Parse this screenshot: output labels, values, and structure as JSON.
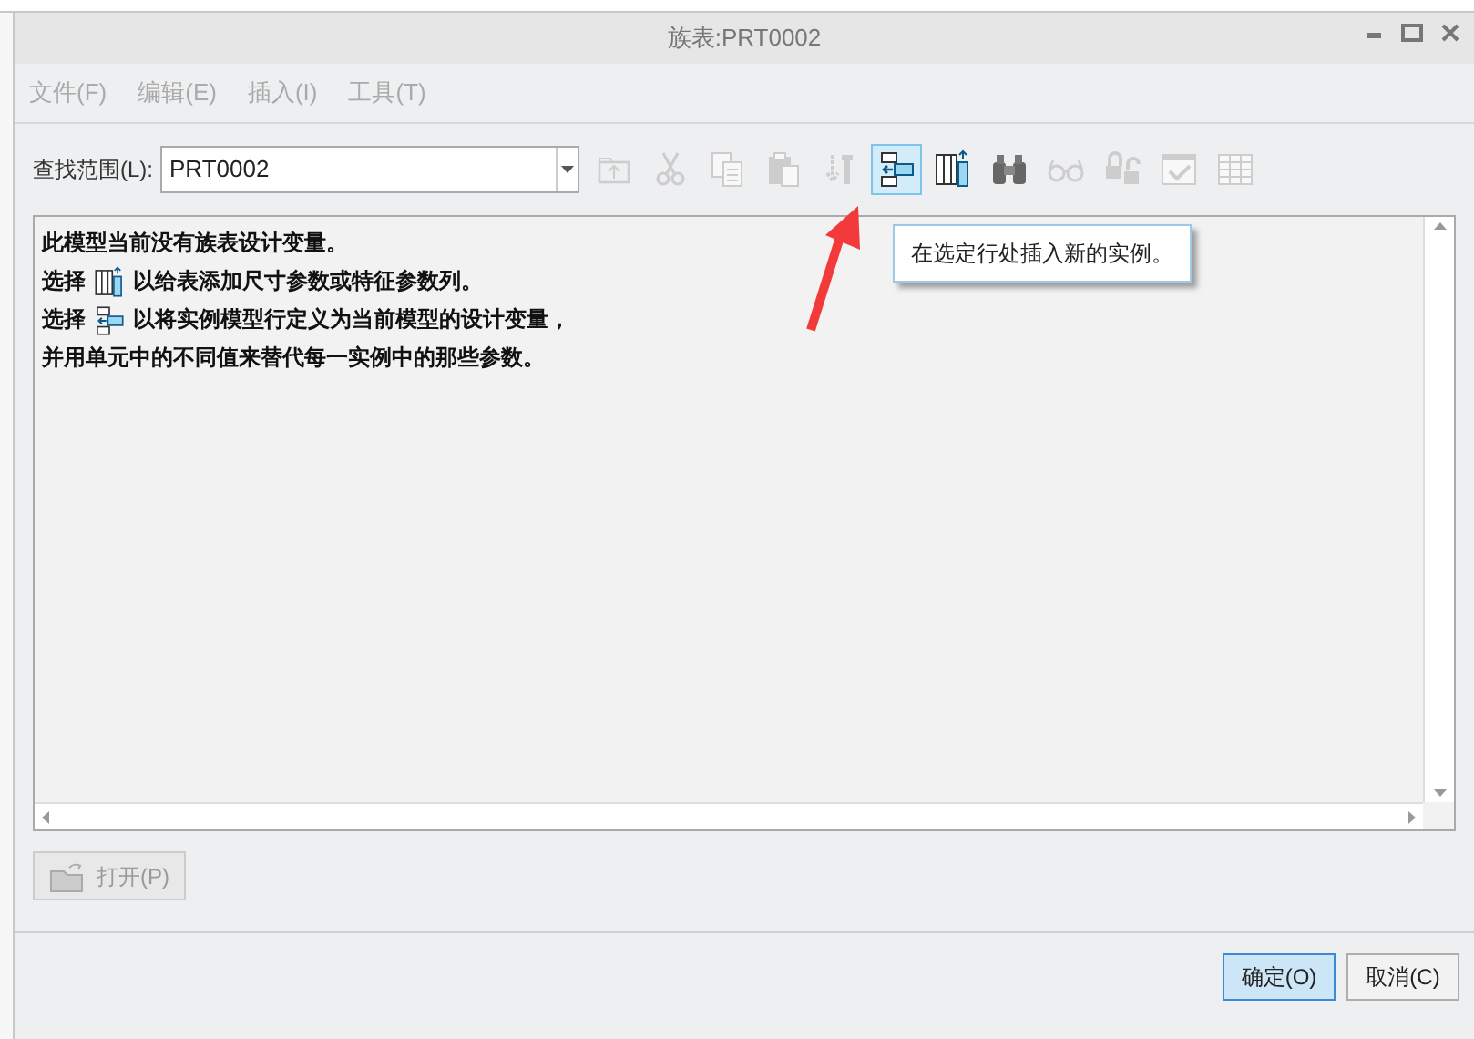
{
  "window": {
    "title": "族表:PRT0002"
  },
  "menu": [
    {
      "label": "文件(F)"
    },
    {
      "label": "编辑(E)"
    },
    {
      "label": "插入(I)"
    },
    {
      "label": "工具(T)"
    }
  ],
  "scope": {
    "label": "查找范围(L):",
    "value": "PRT0002"
  },
  "toolbar": [
    {
      "kind": "folder-up",
      "disabled": true,
      "selected": false
    },
    {
      "kind": "cut",
      "disabled": true,
      "selected": false
    },
    {
      "kind": "copy",
      "disabled": true,
      "selected": false
    },
    {
      "kind": "paste",
      "disabled": true,
      "selected": false
    },
    {
      "kind": "screw",
      "disabled": true,
      "selected": false
    },
    {
      "kind": "insert-row",
      "disabled": false,
      "selected": true
    },
    {
      "kind": "add-column",
      "disabled": false,
      "selected": false
    },
    {
      "kind": "binoculars",
      "disabled": false,
      "selected": false
    },
    {
      "kind": "glasses",
      "disabled": true,
      "selected": false
    },
    {
      "kind": "lock",
      "disabled": true,
      "selected": false
    },
    {
      "kind": "check-table",
      "disabled": true,
      "selected": false
    },
    {
      "kind": "table",
      "disabled": true,
      "selected": false
    }
  ],
  "tooltip": "在选定行处插入新的实例。",
  "message": [
    {
      "kind": "text",
      "text": "此模型当前没有族表设计变量。"
    },
    {
      "kind": "column-hint",
      "prefix": "选择",
      "text": "以给表添加尺寸参数或特征参数列。"
    },
    {
      "kind": "row-hint",
      "prefix": "选择",
      "text": "以将实例模型行定义为当前模型的设计变量，"
    },
    {
      "kind": "text",
      "text": "并用单元中的不同值来替代每一实例中的那些参数。"
    }
  ],
  "open_button": {
    "label": "打开(P)",
    "disabled": true
  },
  "buttons": [
    {
      "label": "确定(O)",
      "selected": true
    },
    {
      "label": "取消(C)",
      "selected": false
    }
  ]
}
